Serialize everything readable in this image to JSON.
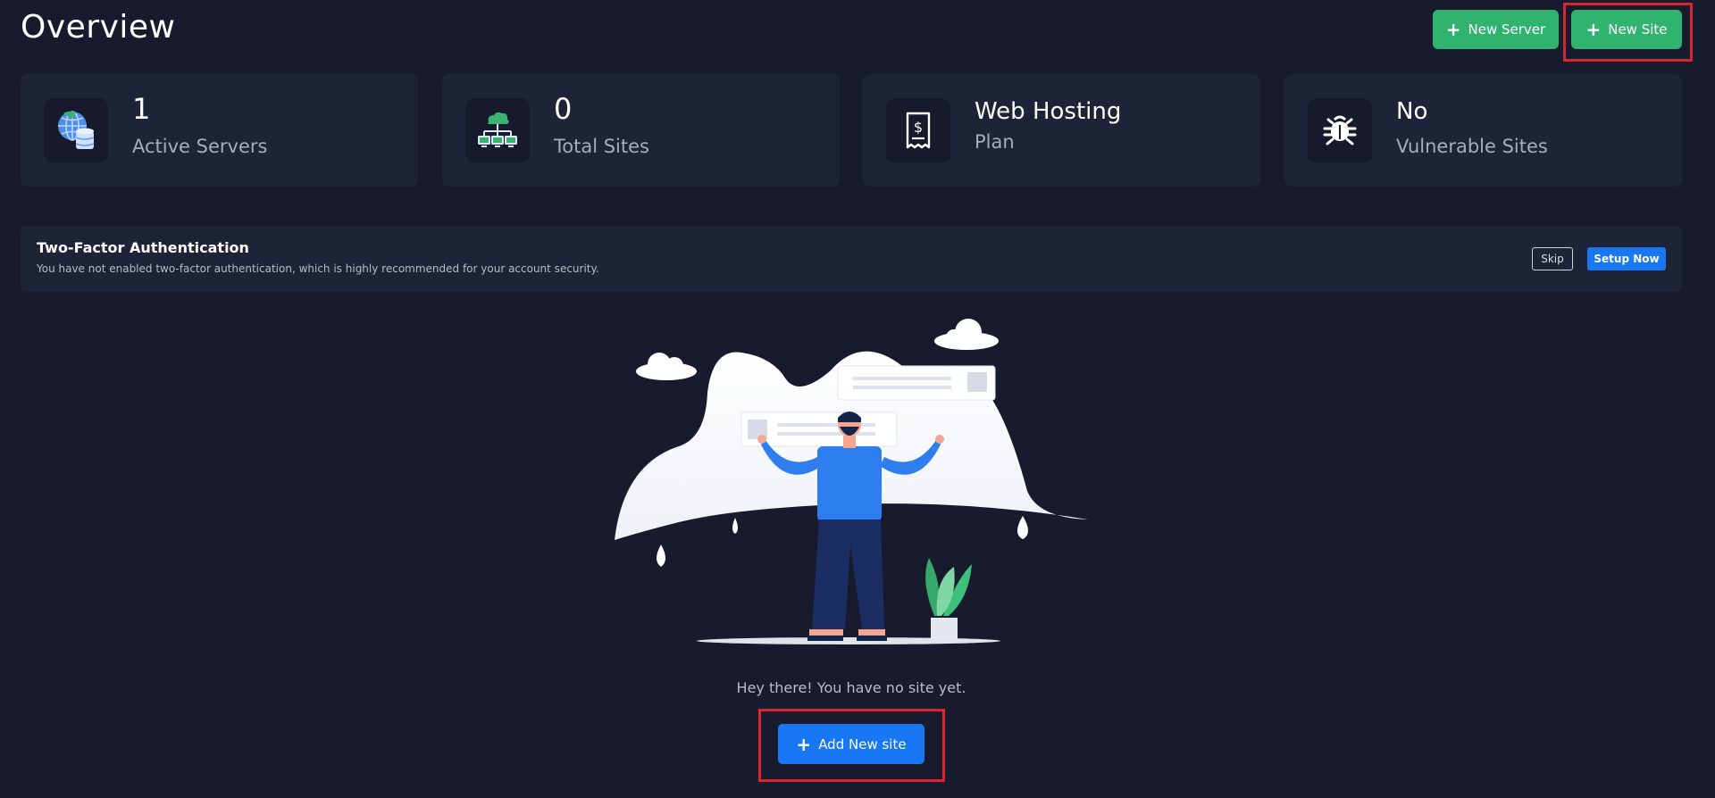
{
  "header": {
    "title": "Overview",
    "new_server_label": "New Server",
    "new_site_label": "New Site"
  },
  "stats": [
    {
      "value": "1",
      "label": "Active Servers",
      "icon": "globe-database-icon"
    },
    {
      "value": "0",
      "label": "Total Sites",
      "icon": "cloud-network-icon"
    },
    {
      "value": "Web Hosting",
      "label": "Plan",
      "icon": "receipt-dollar-icon"
    },
    {
      "value": "No",
      "label": "Vulnerable Sites",
      "icon": "bug-icon"
    }
  ],
  "two_factor": {
    "title": "Two-Factor Authentication",
    "description": "You have not enabled two-factor authentication, which is highly recommended for your account security.",
    "skip_label": "Skip",
    "setup_label": "Setup Now"
  },
  "empty_state": {
    "message": "Hey there! You have no site yet.",
    "add_label": "Add New site"
  },
  "colors": {
    "background": "#181b2e",
    "card": "#1f2338",
    "green": "#2fb36f",
    "blue": "#1877f2",
    "highlight": "#d8262f"
  }
}
